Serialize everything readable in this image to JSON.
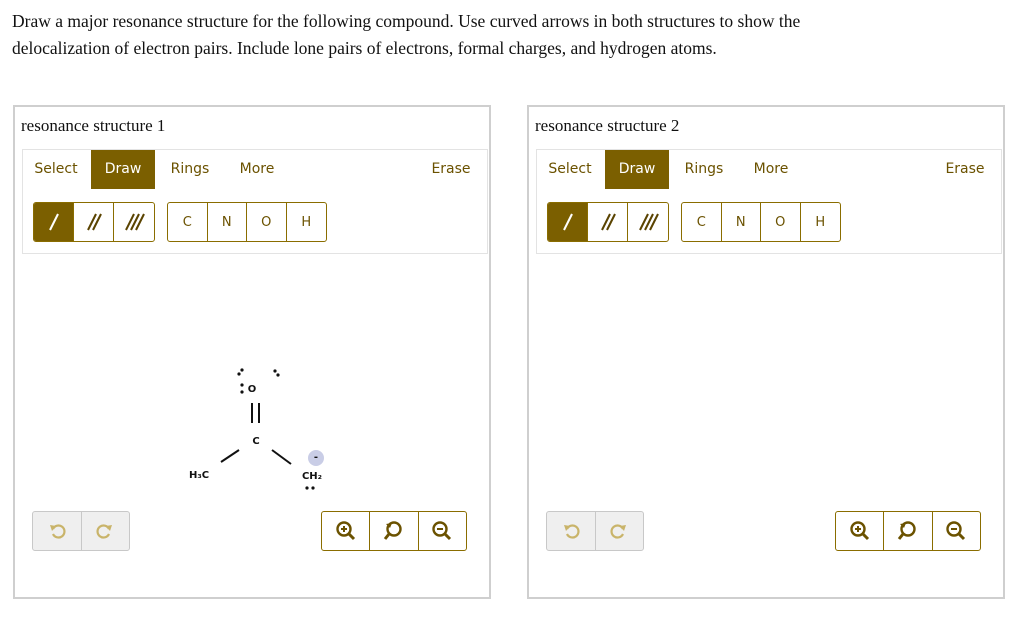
{
  "question": {
    "line1": "Draw a major resonance structure for the following compound. Use curved arrows in both structures to show the",
    "line2": "delocalization of electron pairs. Include lone pairs of electrons, formal charges, and hydrogen atoms."
  },
  "panels": [
    {
      "title": "resonance structure 1",
      "tabs": [
        "Select",
        "Draw",
        "Rings",
        "More"
      ],
      "active_tab": "Draw",
      "erase_label": "Erase",
      "atoms": [
        "C",
        "N",
        "O",
        "H"
      ],
      "molecule": {
        "atom_O": "O",
        "atom_C": "C",
        "atom_left_label": "H₃C",
        "atom_right_label": "CH₂",
        "charge": "-"
      }
    },
    {
      "title": "resonance structure 2",
      "tabs": [
        "Select",
        "Draw",
        "Rings",
        "More"
      ],
      "active_tab": "Draw",
      "erase_label": "Erase",
      "atoms": [
        "C",
        "N",
        "O",
        "H"
      ]
    }
  ],
  "colors": {
    "accent": "#7b5f00",
    "accent_text": "#6b5200",
    "border": "#cfcfcf",
    "charge_circle": "#c9cde6"
  }
}
